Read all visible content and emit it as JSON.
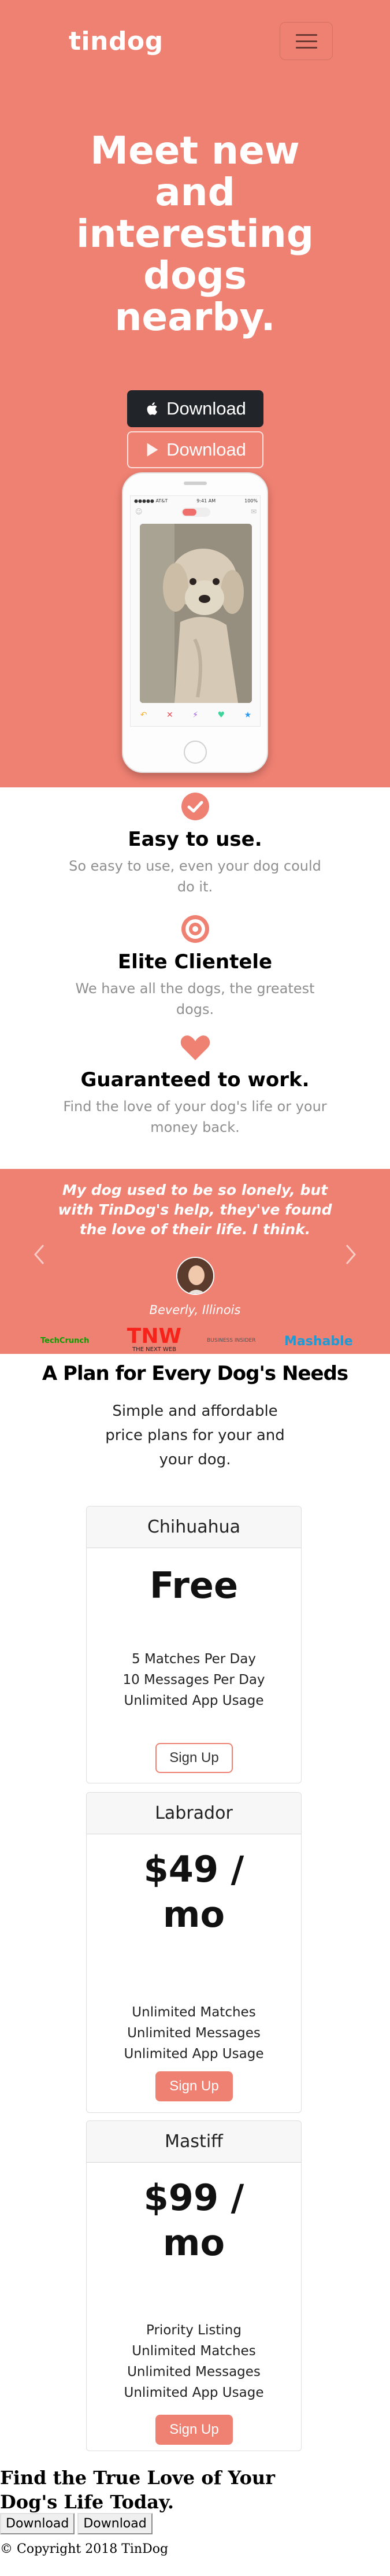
{
  "colors": {
    "accent": "#ef8172",
    "dark": "#212529",
    "muted": "#8f8f8f"
  },
  "nav": {
    "brand": "tindog",
    "toggler_icon": "hamburger-icon"
  },
  "hero": {
    "title_lines": [
      "Meet new",
      "and",
      "interesting",
      "dogs",
      "nearby."
    ],
    "download_apple": "Download",
    "download_google": "Download",
    "apple_icon": "apple-icon",
    "google_icon": "play-icon",
    "phone": {
      "time": "9:41 AM",
      "carrier": "●●●●● AT&T",
      "battery": "100%"
    }
  },
  "features": [
    {
      "icon": "check-circle-icon",
      "title": "Easy to use.",
      "text": "So easy to use, even your dog could do it."
    },
    {
      "icon": "bullseye-icon",
      "title": "Elite Clientele",
      "text": "We have all the dogs, the greatest dogs."
    },
    {
      "icon": "heart-icon",
      "title": "Guaranteed to work.",
      "text": "Find the love of your dog's life or your money back."
    }
  ],
  "testimonial": {
    "quote": "My dog used to be so lonely, but with TinDog's help, they've found the love of their life. I think.",
    "attribution": "Beverly, Illinois",
    "press": [
      "TechCrunch",
      "TNW",
      "BUSINESS INSIDER",
      "Mashable"
    ],
    "press_tnw_sub": "THE NEXT WEB"
  },
  "pricing": {
    "heading": "A Plan for Every Dog's Needs",
    "subheading": "Simple and affordable price plans for your and your dog.",
    "plans": [
      {
        "name": "Chihuahua",
        "price": "Free",
        "features": [
          "5 Matches Per Day",
          "10 Messages Per Day",
          "Unlimited App Usage"
        ],
        "button": "Sign Up"
      },
      {
        "name": "Labrador",
        "price": "$49 / mo",
        "features": [
          "Unlimited Matches",
          "Unlimited Messages",
          "Unlimited App Usage"
        ],
        "button": "Sign Up"
      },
      {
        "name": "Mastiff",
        "price": "$99 / mo",
        "features": [
          "Priority Listing",
          "Unlimited Matches",
          "Unlimited Messages",
          "Unlimited App Usage"
        ],
        "button": "Sign Up"
      }
    ]
  },
  "cta": {
    "text": "Find the True Love of Your Dog's Life Today.",
    "button_1": "Download",
    "button_2": "Download"
  },
  "footer": {
    "copyright": "© Copyright 2018 TinDog"
  }
}
